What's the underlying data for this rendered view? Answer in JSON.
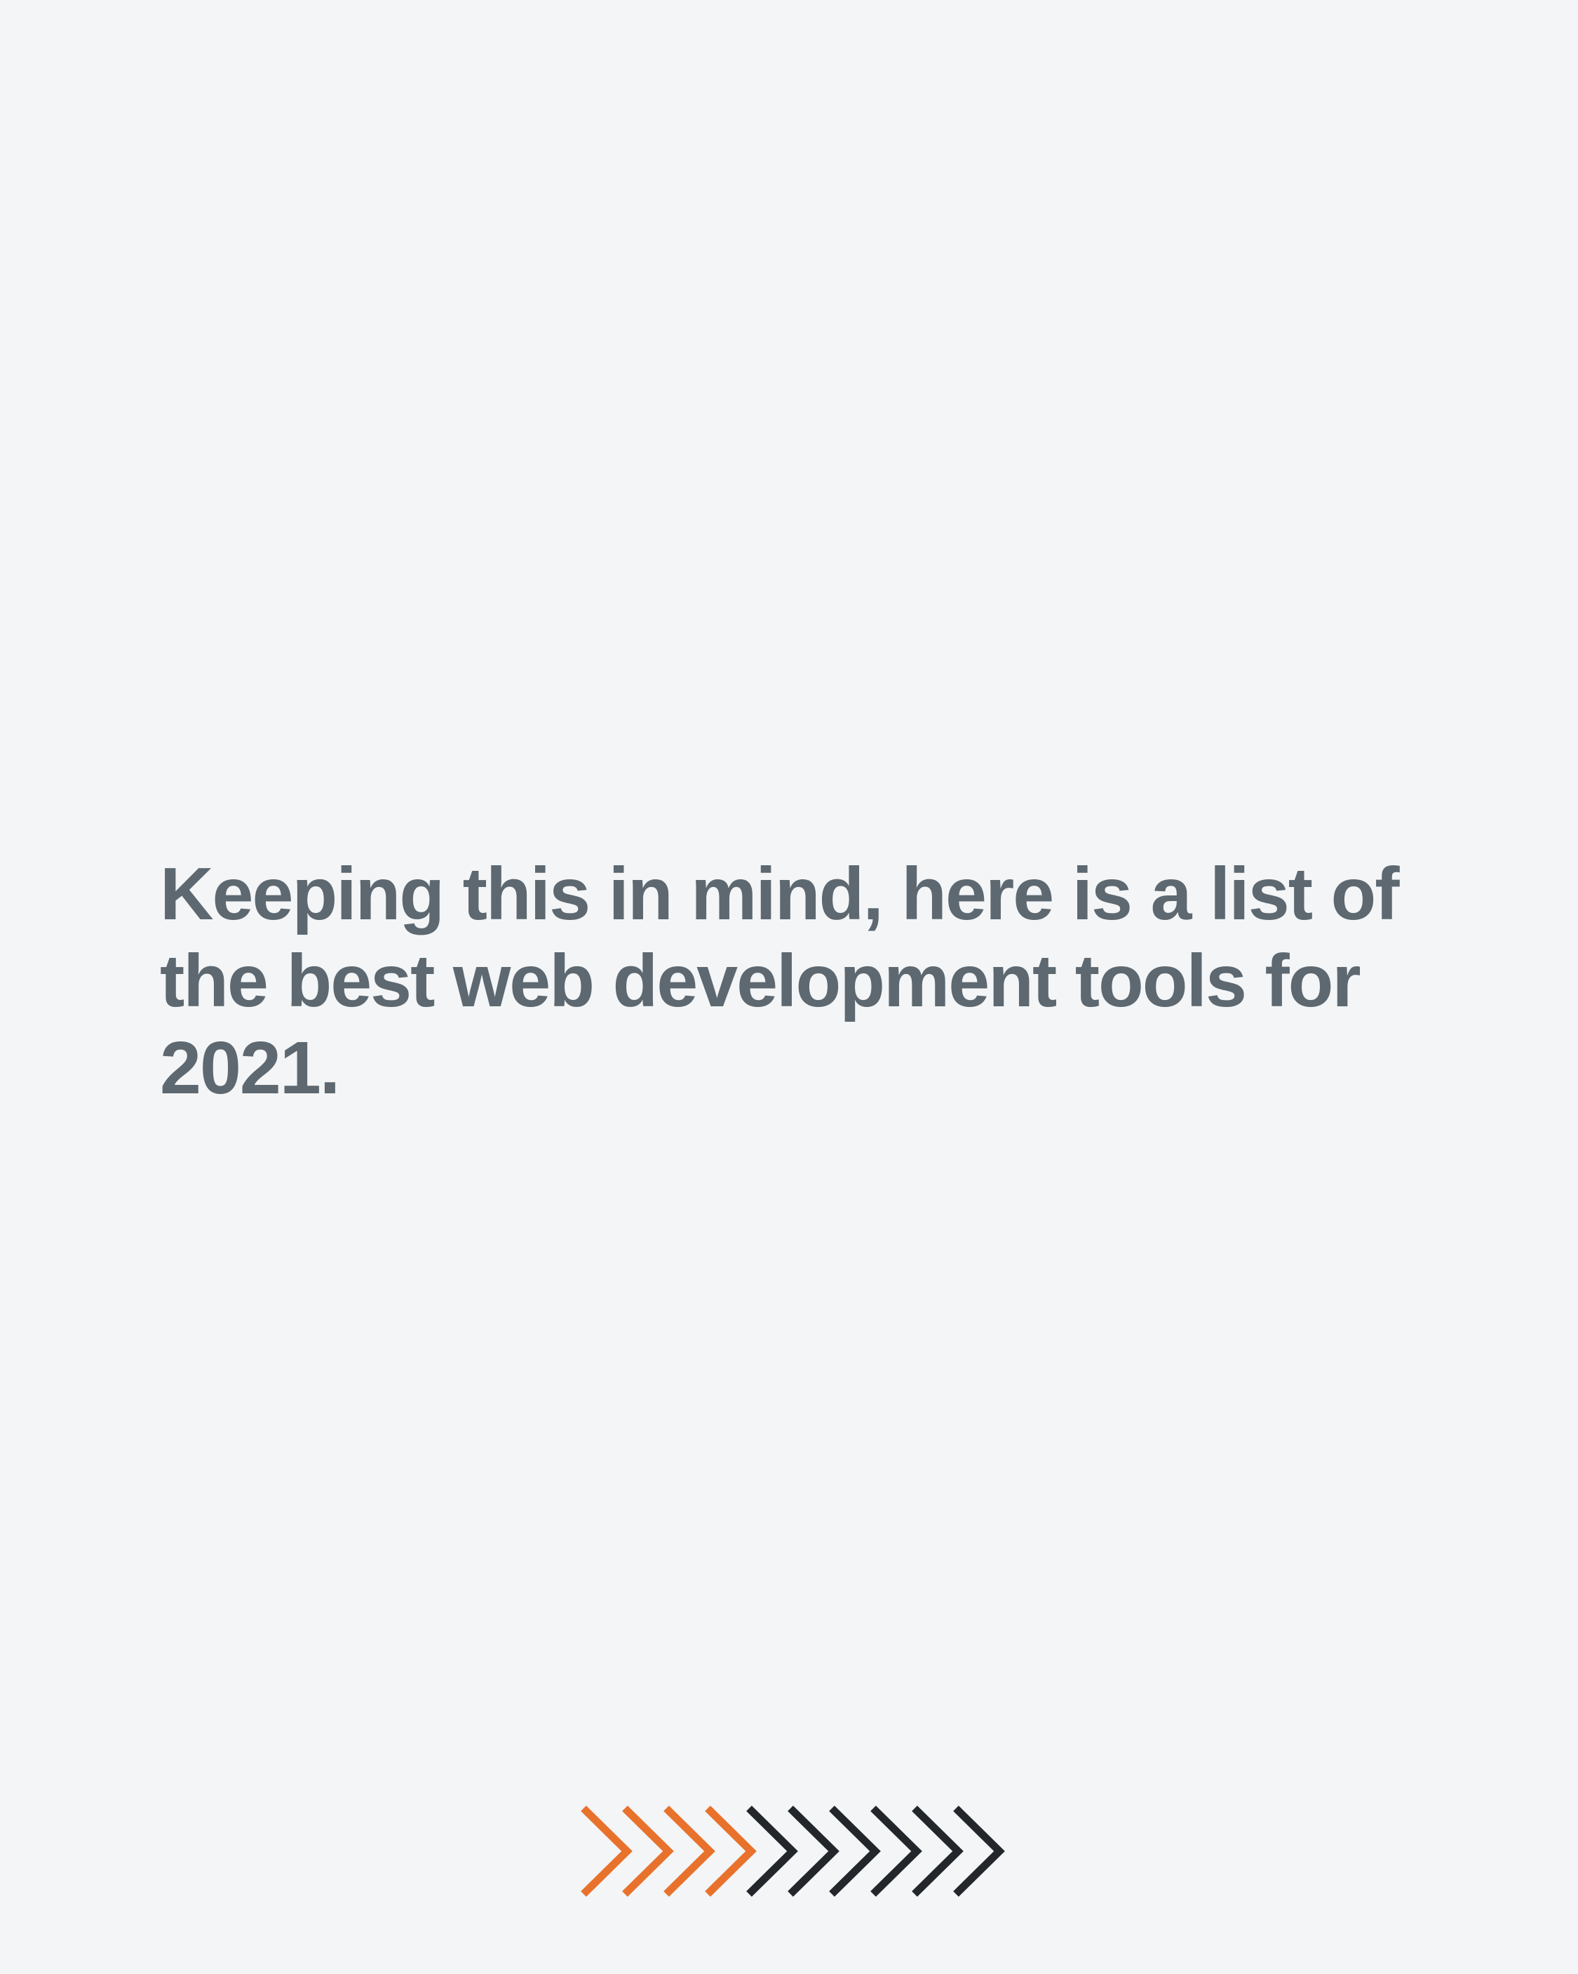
{
  "slide": {
    "headline": "Keeping this in mind, here is a list of the best web development tools for 2021.",
    "text_color": "#5d6870",
    "background_color": "#f3f5f7"
  },
  "progress_indicator": {
    "icon": "chevron-right-icon",
    "total_steps": 10,
    "completed_steps": 4,
    "completed_color": "#e8722c",
    "remaining_color": "#23262b"
  }
}
